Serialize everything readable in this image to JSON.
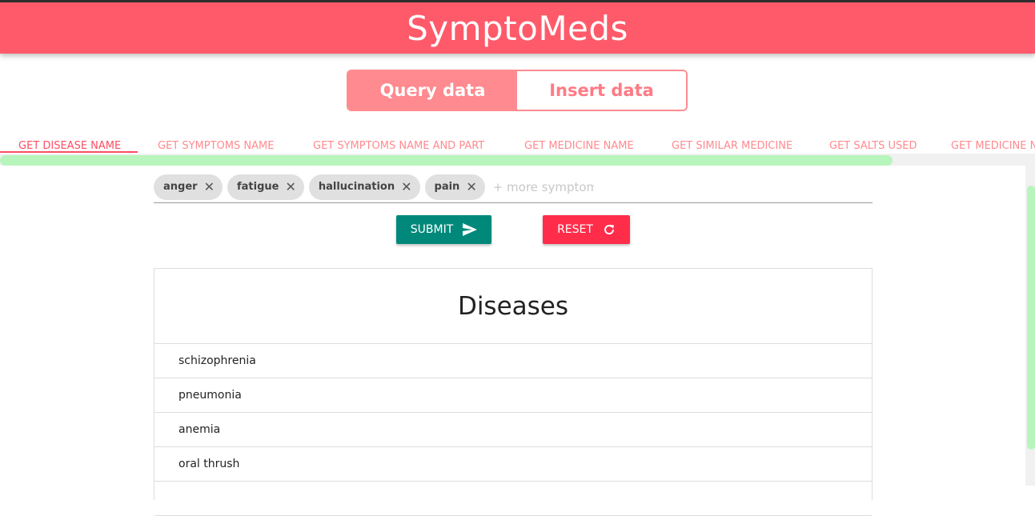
{
  "app": {
    "title": "SymptoMeds"
  },
  "mode_toggle": {
    "query_label": "Query data",
    "insert_label": "Insert data"
  },
  "tabs": [
    {
      "label": "GET DISEASE NAME",
      "active": true
    },
    {
      "label": "GET SYMPTOMS NAME"
    },
    {
      "label": "GET SYMPTOMS NAME AND PART"
    },
    {
      "label": "GET MEDICINE NAME"
    },
    {
      "label": "GET SIMILAR MEDICINE"
    },
    {
      "label": "GET SALTS USED"
    },
    {
      "label": "GET MEDICINE N"
    }
  ],
  "symptoms": {
    "chips": [
      "anger",
      "fatigue",
      "hallucination",
      "pain"
    ],
    "placeholder": "+ more symptoms"
  },
  "buttons": {
    "submit_label": "SUBMIT",
    "reset_label": "RESET"
  },
  "results": {
    "title": "Diseases",
    "items": [
      "schizophrenia",
      "pneumonia",
      "anemia",
      "oral thrush",
      ""
    ]
  },
  "colors": {
    "header": "#ff5a6a",
    "accent": "#ff8a8f",
    "submit": "#00897b",
    "reset": "#ff2d4a",
    "scroll_thumb": "#b8f5bc"
  }
}
